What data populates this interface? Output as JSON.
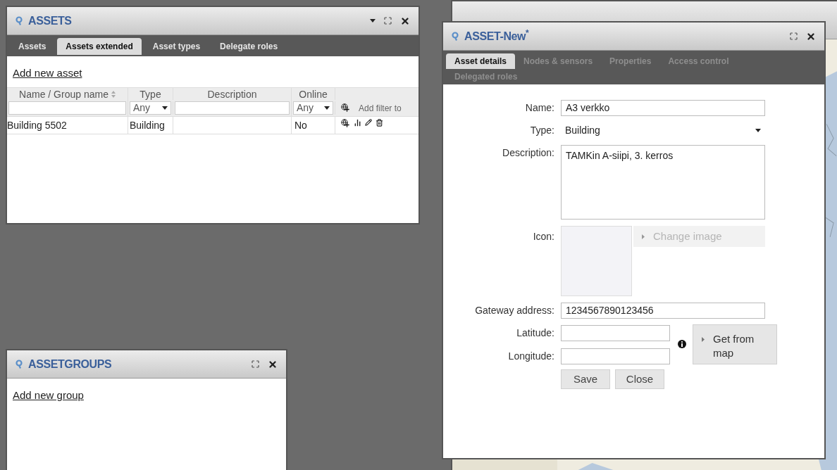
{
  "assets_window": {
    "title": "ASSETS",
    "tabs": [
      {
        "label": "Assets",
        "selected": false
      },
      {
        "label": "Assets extended",
        "selected": true
      },
      {
        "label": "Asset types",
        "selected": false
      },
      {
        "label": "Delegate roles",
        "selected": false
      }
    ],
    "add_link": "Add new asset",
    "table": {
      "columns": [
        {
          "label": "Name / Group name",
          "sortable": true
        },
        {
          "label": "Type",
          "sortable": false
        },
        {
          "label": "Description",
          "sortable": false
        },
        {
          "label": "Online",
          "sortable": false
        }
      ],
      "filters": [
        {
          "kind": "text"
        },
        {
          "kind": "select",
          "value": "Any"
        },
        {
          "kind": "text"
        },
        {
          "kind": "select",
          "value": "Any"
        },
        {
          "kind": "action",
          "label": "Add filter to"
        }
      ],
      "rows": [
        {
          "name": "Building 5502",
          "type": "Building",
          "online": "No"
        }
      ]
    }
  },
  "asset_window": {
    "title": "ASSET-New$^{*}$",
    "tabs": [
      {
        "label": "Asset details",
        "selected": true
      },
      {
        "label": "Nodes & sensors",
        "selected": false
      },
      {
        "label": "Properties",
        "selected": false
      },
      {
        "label": "Access control",
        "selected": false
      },
      {
        "label": "Delegated roles",
        "selected": false
      }
    ],
    "fields": [
      {
        "kind": "text",
        "label": "Name:",
        "value": "A3 verkko"
      },
      {
        "kind": "select",
        "label": "Type:",
        "value": "Building"
      },
      {
        "kind": "textarea",
        "label": "Description:",
        "value": "TAMKin A-siipi, 3. kerros"
      },
      {
        "label": "Icon:",
        "button": "Change image",
        "disabled": true
      },
      {
        "kind": "text",
        "label": "Gateway address:",
        "value": "1234567890123456"
      }
    ],
    "coordinates": {
      "fields": [
        {
          "label": "Latitude:"
        },
        {
          "label": "Longitude:"
        }
      ],
      "button": "Get from map"
    },
    "buttons": [
      "Save",
      "Close"
    ]
  },
  "groups_window": {
    "title": "ASSETGROUPS",
    "add_link": "Add new group"
  }
}
